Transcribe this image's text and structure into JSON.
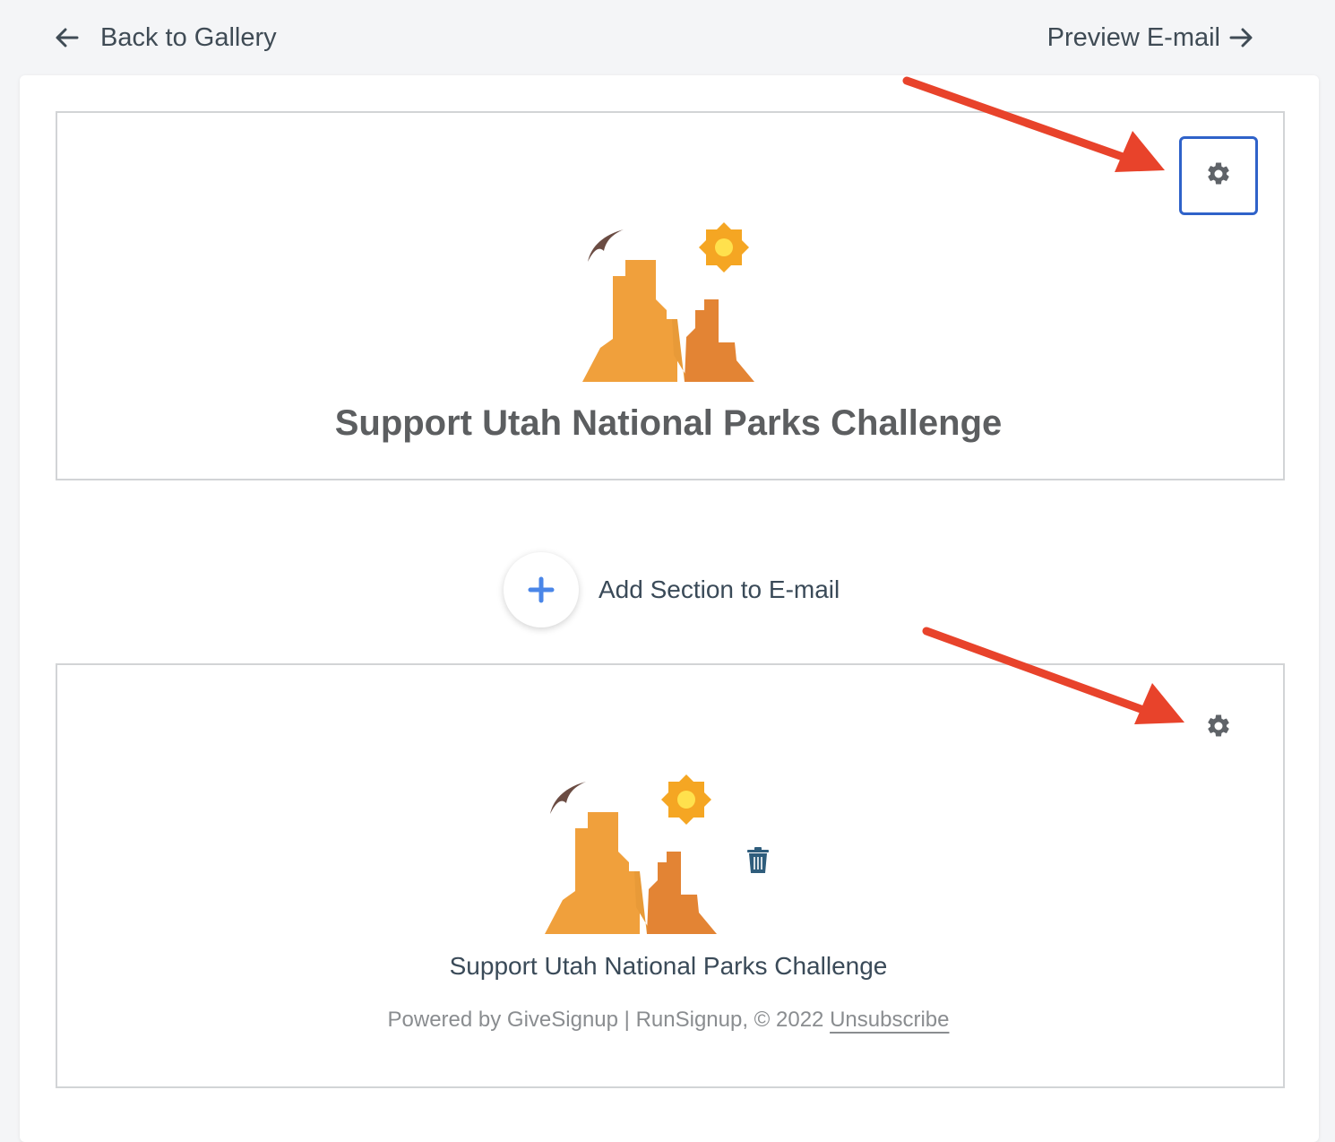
{
  "topbar": {
    "back_label": "Back to Gallery",
    "preview_label": "Preview E-mail"
  },
  "header_section": {
    "title": "Support Utah National Parks Challenge",
    "settings_icon": "gear-icon",
    "selected": true
  },
  "add_section": {
    "label": "Add Section to E-mail",
    "icon": "plus-icon"
  },
  "footer_section": {
    "title": "Support Utah National Parks Challenge",
    "powered_text": "Powered by GiveSignup | RunSignup, © 2022",
    "unsubscribe_label": "Unsubscribe",
    "settings_icon": "gear-icon",
    "delete_icon": "trash-icon"
  },
  "colors": {
    "selection_border": "#2f62c9",
    "annotation_arrow": "#e8432b",
    "plus": "#4a86e8",
    "logo_orange": "#f0a03c",
    "logo_dark_orange": "#e38434",
    "sun": "#f5a623"
  }
}
